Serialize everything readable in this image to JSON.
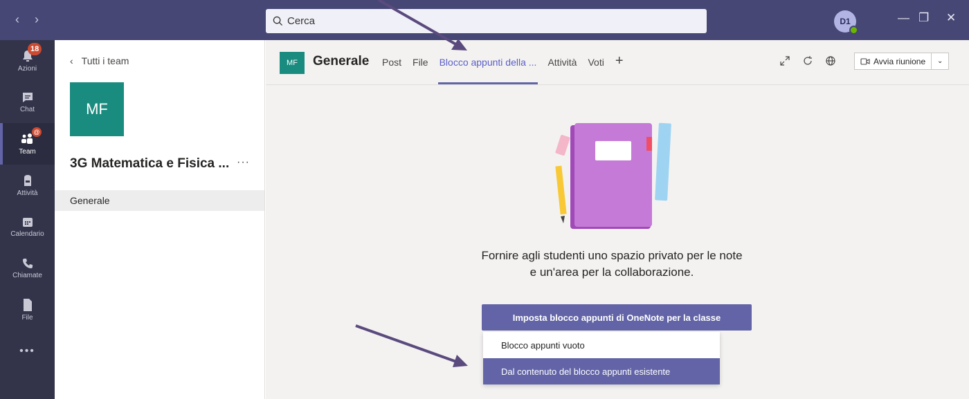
{
  "titlebar": {
    "search_placeholder": "Cerca",
    "avatar_initials": "D1",
    "win_minimize": "—",
    "win_restore": "❐",
    "win_close": "✕"
  },
  "rail": {
    "items": [
      {
        "label": "Azioni",
        "icon": "bell-icon",
        "badge": "18"
      },
      {
        "label": "Chat",
        "icon": "chat-icon"
      },
      {
        "label": "Team",
        "icon": "teams-icon",
        "mention": "@"
      },
      {
        "label": "Attività",
        "icon": "backpack-icon"
      },
      {
        "label": "Calendario",
        "icon": "calendar-icon"
      },
      {
        "label": "Chiamate",
        "icon": "phone-icon"
      },
      {
        "label": "File",
        "icon": "file-icon"
      },
      {
        "label": "•••",
        "icon": "more-icon"
      }
    ]
  },
  "team_panel": {
    "back_label": "Tutti i team",
    "tile_initials": "MF",
    "team_name": "3G Matematica e Fisica ...",
    "more": "···",
    "channel": "Generale"
  },
  "header": {
    "tile_initials": "MF",
    "channel_title": "Generale",
    "tabs": [
      "Post",
      "File",
      "Blocco appunti della ...",
      "Attività",
      "Voti"
    ],
    "active_tab_index": 2,
    "add_tab": "+",
    "meet_label": "Avvia riunione"
  },
  "content": {
    "description_line1": "Fornire agli studenti uno spazio privato per le note",
    "description_line2": "e un'area per la collaborazione.",
    "primary_button": "Imposta blocco appunti di OneNote per la classe",
    "dropdown": [
      "Blocco appunti vuoto",
      "Dal contenuto del blocco appunti esistente"
    ],
    "dropdown_selected_index": 1
  },
  "colors": {
    "titlebar": "#464775",
    "rail": "#33344a",
    "accent": "#6264a7",
    "team_tile": "#1a8b7f",
    "annotation_arrow": "#5b4a7d"
  }
}
